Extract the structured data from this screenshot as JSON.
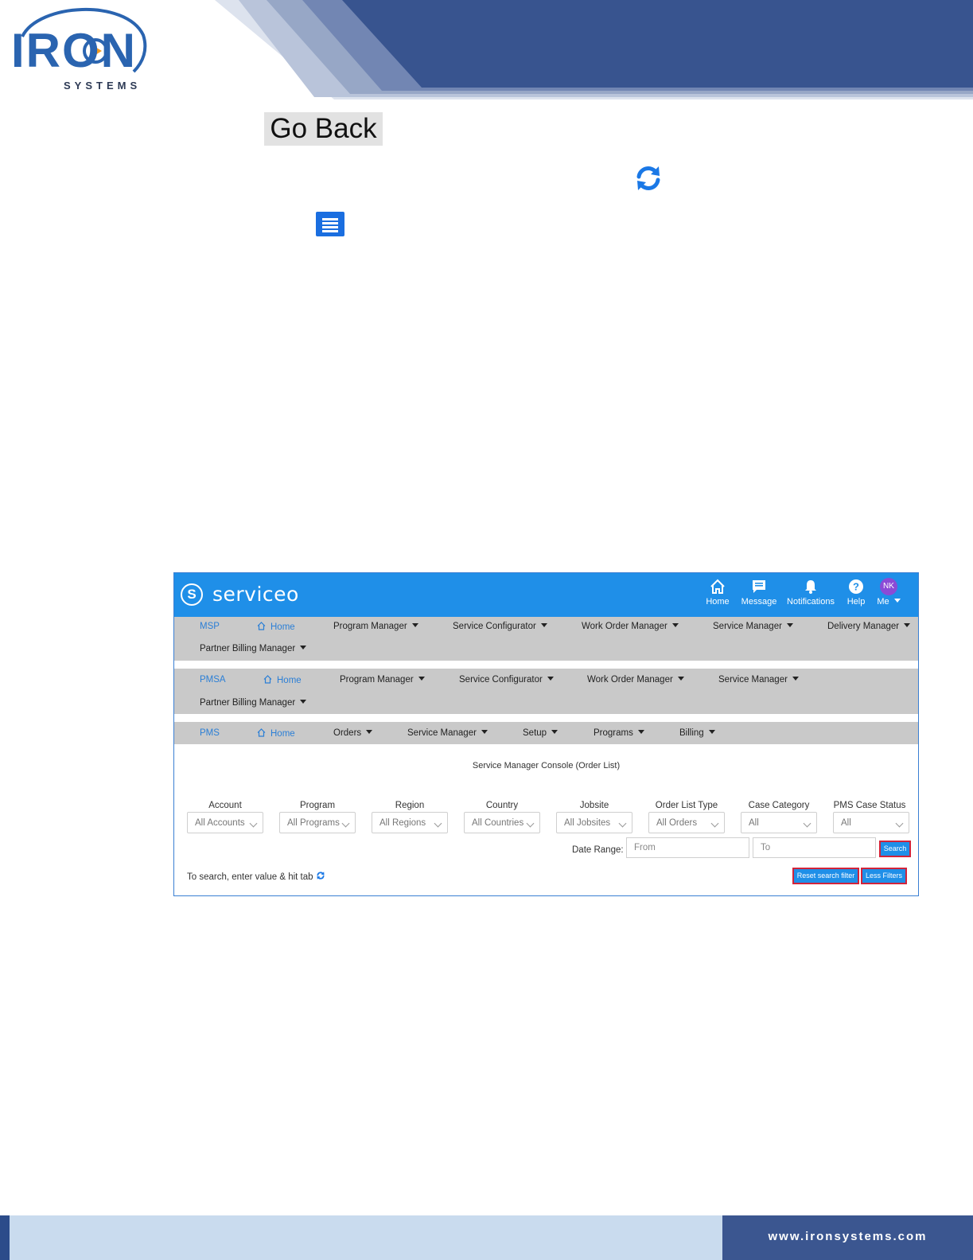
{
  "header": {
    "logo_text": "IRON",
    "logo_subtext": "SYSTEMS"
  },
  "controls": {
    "go_back_label": "Go Back",
    "refresh_icon": "refresh-icon",
    "list_icon": "list-icon"
  },
  "app": {
    "brand": "serviceo",
    "brand_letter": "S",
    "top_nav": [
      {
        "label": "Home",
        "icon": "home-icon"
      },
      {
        "label": "Message",
        "icon": "message-icon"
      },
      {
        "label": "Notifications",
        "icon": "bell-icon"
      },
      {
        "label": "Help",
        "icon": "help-icon"
      },
      {
        "label": "Me",
        "initials": "NK"
      }
    ],
    "nav_rows": [
      {
        "code": "MSP",
        "items": [
          "Home",
          "Program Manager",
          "Service Configurator",
          "Work Order Manager",
          "Service Manager",
          "Delivery Manager",
          "Partner Billing Manager"
        ]
      },
      {
        "code": "PMSA",
        "items": [
          "Home",
          "Program Manager",
          "Service Configurator",
          "Work Order Manager",
          "Service Manager",
          "Partner Billing Manager"
        ]
      },
      {
        "code": "PMS",
        "items": [
          "Home",
          "Orders",
          "Service Manager",
          "Setup",
          "Programs",
          "Billing"
        ]
      }
    ],
    "console_title": "Service Manager Console (Order List)",
    "filters": [
      {
        "label": "Account",
        "value": "All Accounts"
      },
      {
        "label": "Program",
        "value": "All Programs"
      },
      {
        "label": "Region",
        "value": "All Regions"
      },
      {
        "label": "Country",
        "value": "All Countries"
      },
      {
        "label": "Jobsite",
        "value": "All Jobsites"
      },
      {
        "label": "Order List Type",
        "value": "All Orders"
      },
      {
        "label": "Case Category",
        "value": "All"
      },
      {
        "label": "PMS Case Status",
        "value": "All"
      }
    ],
    "date_range": {
      "label": "Date Range:",
      "from_placeholder": "From",
      "to_placeholder": "To"
    },
    "search_label": "Search",
    "reset_label": "Reset search filter",
    "less_filters_label": "Less Filters",
    "hint": "To search, enter value & hit tab"
  },
  "footer": {
    "url": "www.ironsystems.com"
  },
  "colors": {
    "brand_blue": "#1f8fe8",
    "header_navy": "#38548f",
    "highlight_red": "#d2233a"
  }
}
